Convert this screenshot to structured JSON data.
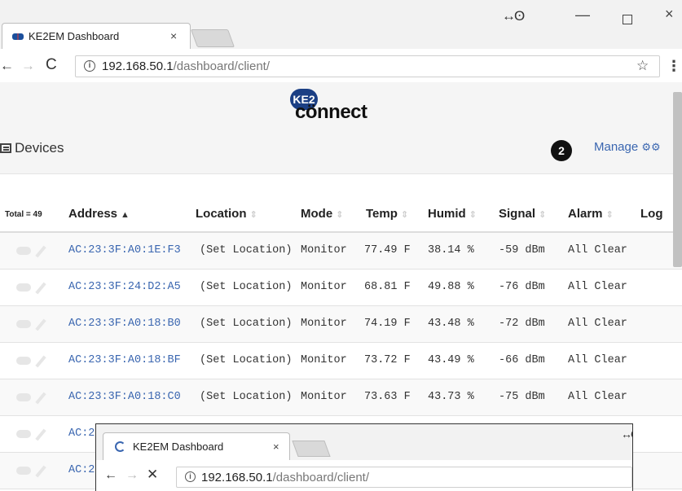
{
  "browser": {
    "tab_title": "KE2EM Dashboard",
    "tab_close": "×",
    "profile_icon": "↔ʘ",
    "min": "—",
    "close": "×",
    "back": "←",
    "forward": "→",
    "reload": "C",
    "info": "i",
    "url_host": "192.168.50.1",
    "url_path": "/dashboard/client/",
    "star": "☆",
    "menu": "⋮"
  },
  "logo": {
    "mark": "KE2",
    "text": "cönnect"
  },
  "devices": {
    "title": "Devices",
    "badge": "2",
    "manage_label": "Manage",
    "manage_icon": "⚙⚙"
  },
  "table": {
    "total_label": "Total = 49",
    "columns": [
      "Address",
      "Location",
      "Mode",
      "Temp",
      "Humid",
      "Signal",
      "Alarm",
      "Log"
    ],
    "rows": [
      {
        "address": "AC:23:3F:A0:1E:F3",
        "location": "(Set Location)",
        "mode": "Monitor",
        "temp": "77.49 F",
        "humid": "38.14 %",
        "signal": "-59 dBm",
        "alarm": "All Clear"
      },
      {
        "address": "AC:23:3F:24:D2:A5",
        "location": "(Set Location)",
        "mode": "Monitor",
        "temp": "68.81 F",
        "humid": "49.88 %",
        "signal": "-76 dBm",
        "alarm": "All Clear"
      },
      {
        "address": "AC:23:3F:A0:18:B0",
        "location": "(Set Location)",
        "mode": "Monitor",
        "temp": "74.19 F",
        "humid": "43.48 %",
        "signal": "-72 dBm",
        "alarm": "All Clear"
      },
      {
        "address": "AC:23:3F:A0:18:BF",
        "location": "(Set Location)",
        "mode": "Monitor",
        "temp": "73.72 F",
        "humid": "43.49 %",
        "signal": "-66 dBm",
        "alarm": "All Clear"
      },
      {
        "address": "AC:23:3F:A0:18:C0",
        "location": "(Set Location)",
        "mode": "Monitor",
        "temp": "73.63 F",
        "humid": "43.73 %",
        "signal": "-75 dBm",
        "alarm": "All Clear"
      },
      {
        "address": "AC:2",
        "location": "",
        "mode": "",
        "temp": "",
        "humid": "",
        "signal": "",
        "alarm": ""
      },
      {
        "address": "AC:2",
        "location": "",
        "mode": "",
        "temp": "",
        "humid": "",
        "signal": "",
        "alarm": ""
      }
    ]
  },
  "popup": {
    "tab_title": "KE2EM Dashboard",
    "tab_close": "×",
    "profile_icon": "↔ʘ",
    "back": "←",
    "forward": "→",
    "stop": "✕",
    "info": "i",
    "url_host": "192.168.50.1",
    "url_path": "/dashboard/client/"
  },
  "colors": {
    "link": "#3a66b0",
    "brand": "#1b3f84"
  }
}
